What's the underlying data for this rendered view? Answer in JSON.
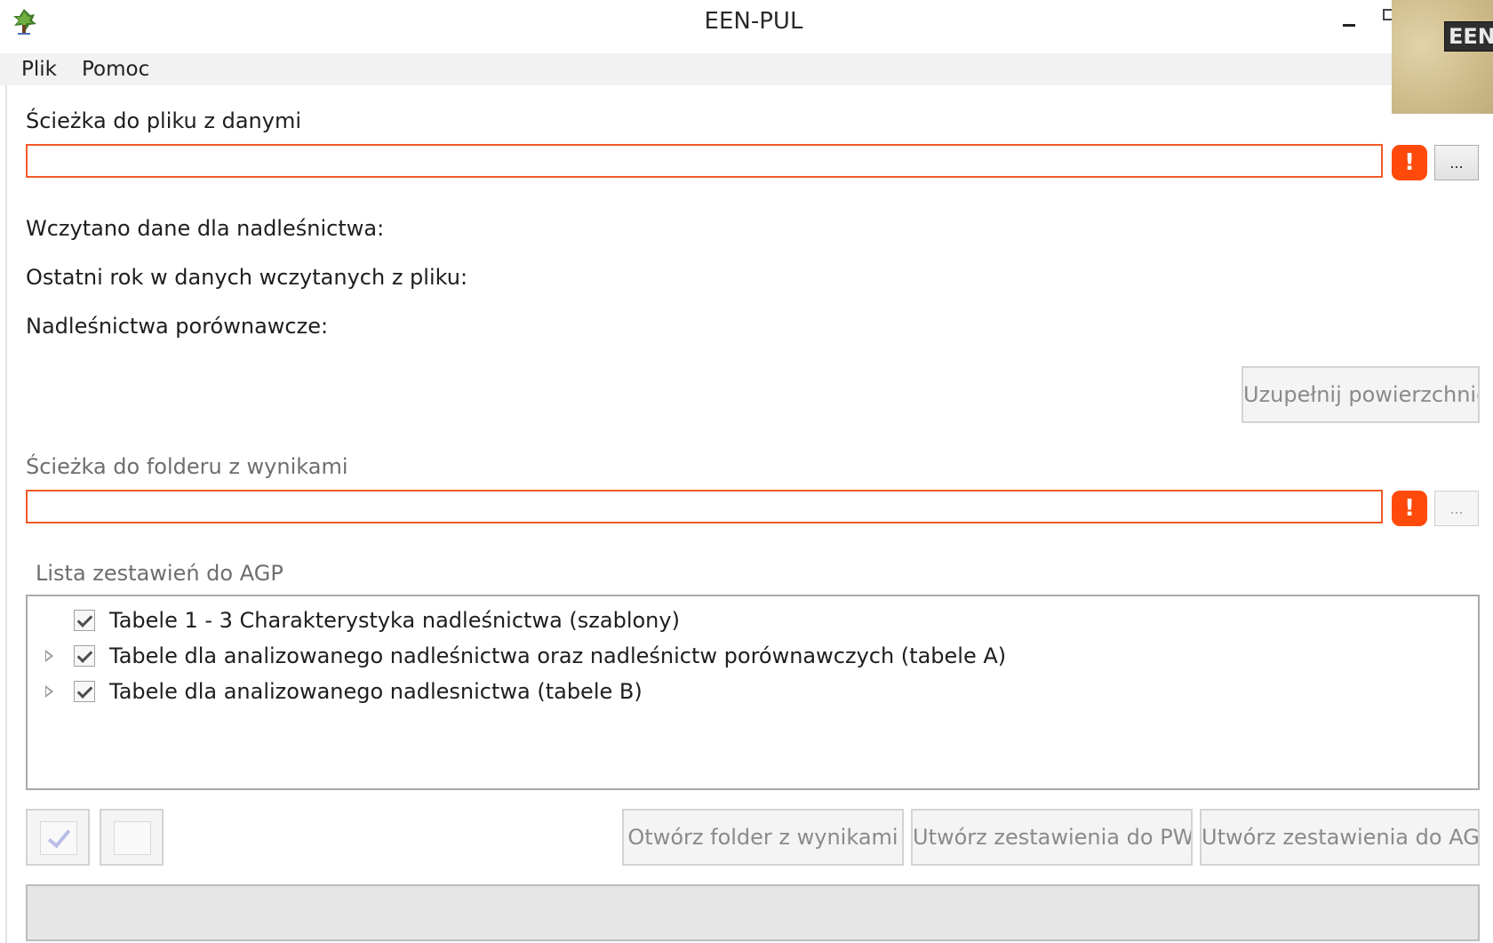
{
  "window": {
    "title": "EEN-PUL"
  },
  "overlay": {
    "label": "EEN"
  },
  "menu": {
    "items": [
      "Plik",
      "Pomoc"
    ]
  },
  "data_file": {
    "label": "Ścieżka do pliku z danymi",
    "value": "",
    "error_symbol": "!",
    "browse_label": "..."
  },
  "info": {
    "loaded_for": "Wczytano dane dla nadleśnictwa:",
    "last_year": "Ostatni rok w danych wczytanych z pliku:",
    "comparative": "Nadleśnictwa porównawcze:"
  },
  "fill_area_button": "Uzupełnij powierzchnię",
  "output_folder": {
    "label": "Ścieżka do folderu z wynikami",
    "value": "",
    "error_symbol": "!",
    "browse_label": "..."
  },
  "list": {
    "title": "Lista zestawień do AGP",
    "items": [
      {
        "label": "Tabele 1 - 3 Charakterystyka nadleśnictwa (szablony)",
        "checked": true,
        "expandable": false
      },
      {
        "label": "Tabele dla analizowanego nadleśnictwa oraz nadleśnictw porównawczych (tabele A)",
        "checked": true,
        "expandable": true
      },
      {
        "label": "Tabele dla analizowanego nadlesnictwa (tabele B)",
        "checked": true,
        "expandable": true
      }
    ]
  },
  "actions": {
    "open_folder": "Otwórz folder z wynikami",
    "create_pwf": "Utwórz zestawienia do PWF",
    "create_agp": "Utwórz zestawienia do AGP"
  },
  "progress": {
    "value": 0
  },
  "colors": {
    "error": "#ff4a0b",
    "input_border_error": "#f05a28"
  }
}
